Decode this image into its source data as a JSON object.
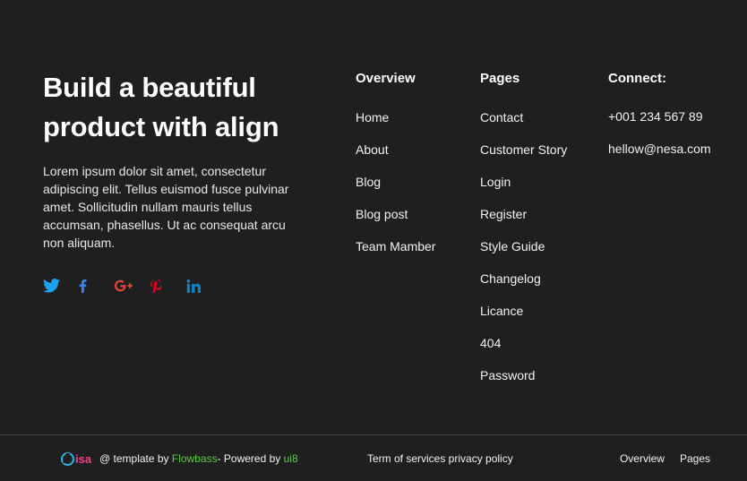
{
  "brand": {
    "headline": "Build a beautiful product with align",
    "description": "Lorem ipsum dolor sit amet, consectetur adipiscing elit. Tellus euismod fusce pulvinar amet. Sollicitudin nullam mauris tellus accumsan, phasellus. Ut ac consequat arcu non aliquam."
  },
  "socials": [
    {
      "icon": "twitter-icon",
      "color": "#1da1f2"
    },
    {
      "icon": "facebook-icon",
      "color": "#3b82f6"
    },
    {
      "icon": "google-plus-icon",
      "color": "#db4437"
    },
    {
      "icon": "pinterest-icon",
      "color": "#e60023"
    },
    {
      "icon": "linkedin-icon",
      "color": "#0a84c8"
    }
  ],
  "columns": {
    "overview": {
      "title": "Overview",
      "links": [
        "Home",
        "About",
        "Blog",
        "Blog post",
        "Team Mamber"
      ]
    },
    "pages": {
      "title": "Pages",
      "links": [
        "Contact",
        "Customer Story",
        "Login",
        "Register",
        "Style Guide",
        "Changelog",
        "Licance",
        "404",
        "Password"
      ]
    },
    "connect": {
      "title": "Connect:",
      "phone": "+001 234 567 89",
      "email": "hellow@nesa.com"
    }
  },
  "bottom": {
    "logo_text": "isa",
    "credit_prefix": "@ template by ",
    "credit_flowbass": "Flowbass",
    "credit_middle": "- Powered by ",
    "credit_ui8": "ui8",
    "terms": "Term of services privacy policy",
    "nav": [
      "Overview",
      "Pages"
    ]
  },
  "colors": {
    "background": "#1f1f1f",
    "accent_green": "#5ec94a",
    "logo_pink": "#f24389",
    "logo_blue": "#27b6e8"
  }
}
